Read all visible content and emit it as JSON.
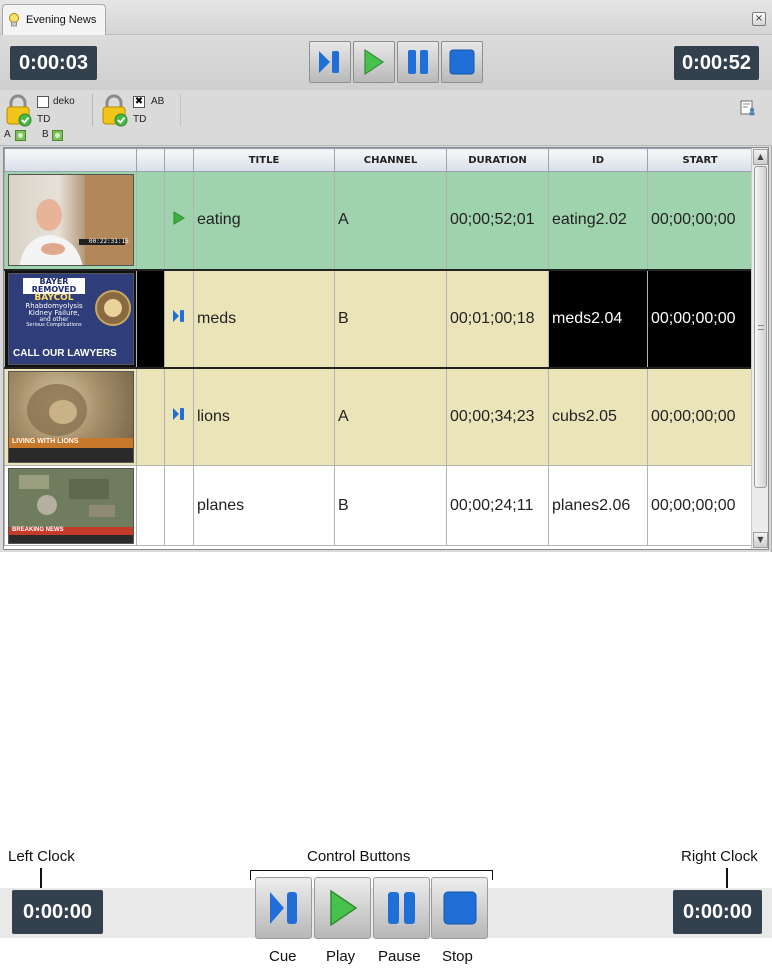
{
  "window": {
    "tab_title": "Evening News",
    "close_label": "×"
  },
  "control_bar": {
    "left_clock": "0:00:03",
    "right_clock": "0:00:52",
    "buttons": [
      "cue-icon",
      "play-icon",
      "pause-icon",
      "stop-icon"
    ]
  },
  "locks": {
    "group1": {
      "checkbox_label": "deko",
      "checked": false,
      "sub_label": "TD",
      "channel_a": "A",
      "channel_b": "B"
    },
    "group2": {
      "checkbox_label": "AB",
      "checked": true,
      "sub_label": "TD"
    }
  },
  "table": {
    "columns": [
      "",
      "",
      "",
      "TITLE",
      "CHANNEL",
      "DURATION",
      "ID",
      "START"
    ],
    "rows": [
      {
        "status_icon": "play-icon",
        "title": "eating",
        "channel": "A",
        "duration": "00;00;52;01",
        "id": "eating2.02",
        "start": "00;00;00;00",
        "state": "played"
      },
      {
        "status_icon": "cue-icon",
        "title": "meds",
        "channel": "B",
        "duration": "00;01;00;18",
        "id": "meds2.04",
        "start": "00;00;00;00",
        "state": "cued-selected"
      },
      {
        "status_icon": "cue-icon",
        "title": "lions",
        "channel": "A",
        "duration": "00;00;34;23",
        "id": "cubs2.05",
        "start": "00;00;00;00",
        "state": "cued"
      },
      {
        "status_icon": "",
        "title": "planes",
        "channel": "B",
        "duration": "00;00;24;11",
        "id": "planes2.06",
        "start": "00;00;00;00",
        "state": "plain"
      }
    ],
    "thumbnail_texts": {
      "row1": "00:22:31:15",
      "row2_lines": [
        "BAYER",
        "REMOVED",
        "BAYCOL",
        "Rhabdomyolysis",
        "Kidney Failure,",
        "and other",
        "Serious Complications",
        "CALL OUR LAWYERS"
      ],
      "row3": "LIVING WITH LIONS",
      "row4": "BREAKING NEWS"
    }
  },
  "legend": {
    "left_clock_label": "Left Clock",
    "right_clock_label": "Right Clock",
    "control_buttons_label": "Control Buttons",
    "left_clock_value": "0:00:00",
    "right_clock_value": "0:00:00",
    "button_labels": [
      "Cue",
      "Play",
      "Pause",
      "Stop"
    ]
  },
  "colors": {
    "played_row": "#9fd3ae",
    "cued_row": "#ece4b9",
    "clock_bg": "#33414f",
    "button_blue": "#1f6fd6",
    "play_green": "#3cb043"
  }
}
